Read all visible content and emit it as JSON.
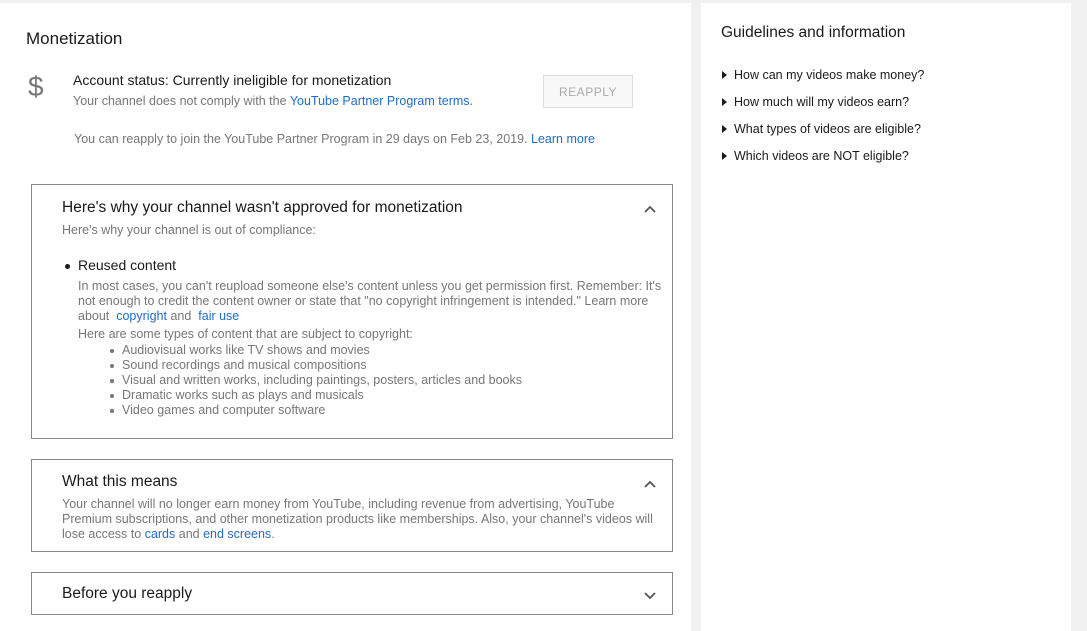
{
  "monetization": {
    "title": "Monetization",
    "dollar_symbol": "$",
    "status": "Account status: Currently ineligible for monetization",
    "status_sub_prefix": "Your channel does not comply with the ",
    "status_sub_link": "YouTube Partner Program terms.",
    "reapply_button": "REAPPLY",
    "reapply_note_prefix": "You can reapply to join the YouTube Partner Program in 29 days on Feb 23, 2019. ",
    "reapply_note_link": "Learn more"
  },
  "panel_why": {
    "title": "Here's why your channel wasn't approved for monetization",
    "subtitle": "Here's why your channel is out of compliance:",
    "bullet": "Reused content",
    "para1": "In most cases, you can't reupload someone else's content unless you get permission first. Remember: It's not enough to credit the content owner or state that \"no copyright infringement is intended.\" Learn more about",
    "link_copyright": "copyright",
    "and": "and",
    "link_fair_use": "fair use",
    "para2": "Here are some types of content that are subject to copyright:",
    "items": [
      "Audiovisual works like TV shows and movies",
      "Sound recordings and musical compositions",
      "Visual and written works, including paintings, posters, articles and books",
      "Dramatic works such as plays and musicals",
      "Video games and computer software"
    ]
  },
  "panel_means": {
    "title": "What this means",
    "text_prefix": "Your channel will no longer earn money from YouTube, including revenue from advertising, YouTube Premium subscriptions, and other monetization products like memberships. Also, your channel's videos will lose access to ",
    "link_cards": "cards",
    "and": " and ",
    "link_end_screens": "end screens",
    "period": "."
  },
  "panel_before": {
    "title": "Before you reapply"
  },
  "sidebar": {
    "title": "Guidelines and information",
    "items": [
      "How can my videos make money?",
      "How much will my videos earn?",
      "What types of videos are eligible?",
      "Which videos are NOT eligible?"
    ]
  },
  "icons": {
    "expand_less": "chevron-up-icon",
    "expand_more": "chevron-down-icon",
    "bullet_arrow": "triangle-right-icon",
    "dollar": "dollar-icon"
  },
  "colors": {
    "link": "#1f6cc9",
    "muted_text": "#777777",
    "panel_border": "#888888",
    "page_bg": "#f1f1f1"
  }
}
